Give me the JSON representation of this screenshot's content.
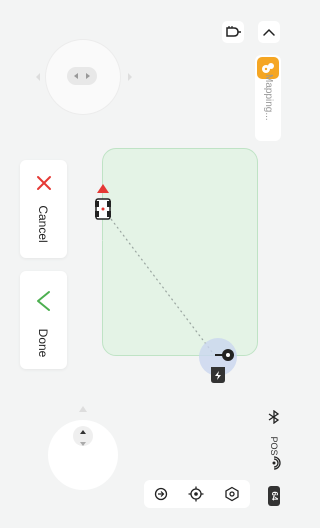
{
  "left_panel": {
    "cancel_label": "Cancel",
    "done_label": "Done"
  },
  "right_panel": {
    "mapping_label": "Mapping...",
    "pos_label": "POS",
    "battery_value": "64"
  },
  "icons": {
    "device_top": "router-icon",
    "collapse": "chevron-up-icon",
    "mapping": "mapping-robot-icon",
    "bluetooth": "bluetooth-icon",
    "pos_signal": "signal-icon",
    "battery": "battery-icon",
    "toolbar": [
      "rotate-icon",
      "locate-icon",
      "settings-icon"
    ],
    "map": [
      "target-flag-icon",
      "robot-marker-icon",
      "charging-base-icon"
    ]
  },
  "colors": {
    "accent_orange": "#f5a623",
    "cancel_red": "#e53935",
    "done_green": "#4caf50",
    "area_fill": "#e4f3e6"
  }
}
